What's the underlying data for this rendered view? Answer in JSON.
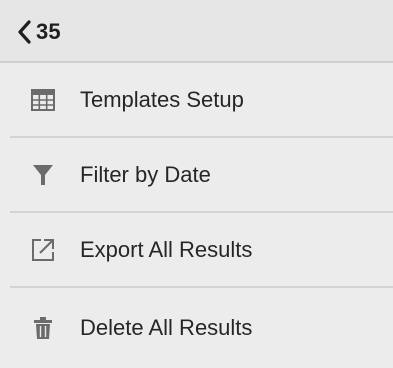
{
  "header": {
    "back_icon": "chevron-left-icon",
    "count": "35"
  },
  "menu": {
    "items": [
      {
        "label": "Templates Setup",
        "icon": "grid-table-icon"
      },
      {
        "label": "Filter by Date",
        "icon": "funnel-filter-icon"
      },
      {
        "label": "Export All Results",
        "icon": "export-icon"
      },
      {
        "label": "Delete All Results",
        "icon": "trash-icon"
      }
    ]
  },
  "colors": {
    "background": "#ececec",
    "header_background": "#e6e6e6",
    "divider": "#d4d4d4",
    "text": "#262626",
    "icon": "#6b6b6b"
  }
}
